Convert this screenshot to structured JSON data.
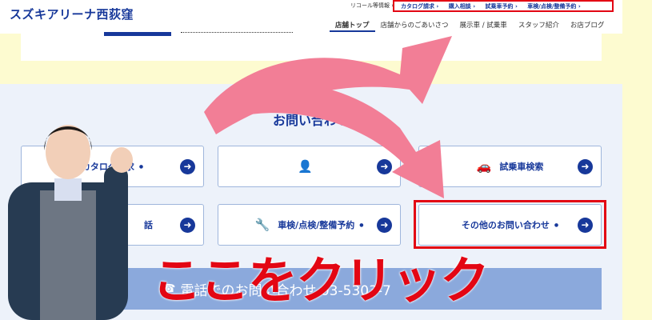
{
  "header": {
    "brand": "スズキアリーナ西荻窪",
    "recall": "リコール等情報 ›",
    "util_links": [
      "カタログ請求 ›",
      "購入相談 ›",
      "試乗車予約 ›",
      "車検/点検/整備予約 ›"
    ],
    "nav": [
      "店舗トップ",
      "店舗からのごあいさつ",
      "展示車 / 試乗車",
      "スタッフ紹介",
      "お店ブログ"
    ]
  },
  "contact": {
    "title": "お問い合わせ",
    "buttons": [
      {
        "label": "カタログ請求",
        "icon": "catalog-icon"
      },
      {
        "label": "",
        "icon": "consultation-icon"
      },
      {
        "label": "試乗車検索",
        "icon": "car-icon"
      },
      {
        "label": "話",
        "icon": ""
      },
      {
        "label": "車検/点検/整備予約",
        "icon": "wrench-icon"
      },
      {
        "label": "その他のお問い合わせ",
        "icon": ""
      }
    ],
    "phone": "電話でのお問い合わせ 03-5303-7"
  },
  "overlay": {
    "click_here": "ここをクリック"
  },
  "colors": {
    "brand": "#17389a",
    "highlight": "#e30613",
    "arrow": "#f27e96"
  }
}
